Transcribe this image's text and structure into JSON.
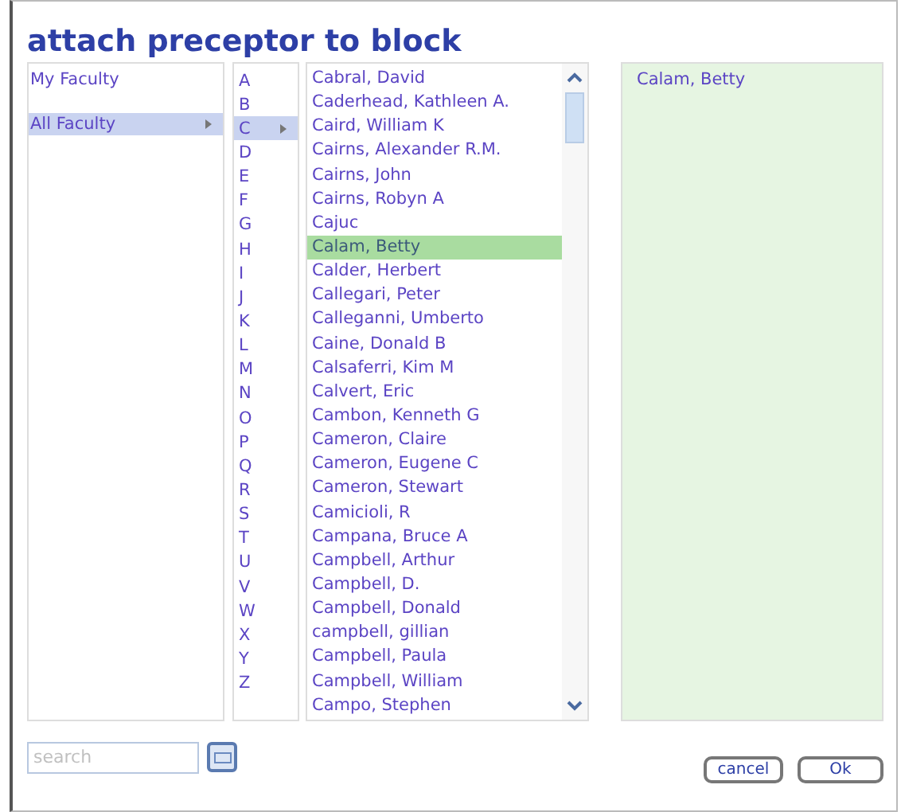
{
  "title": "attach preceptor to block",
  "faculty": [
    {
      "label": "My Faculty",
      "selected": false
    },
    {
      "label": "All Faculty",
      "selected": true
    }
  ],
  "letters": [
    {
      "label": "A",
      "selected": false
    },
    {
      "label": "B",
      "selected": false
    },
    {
      "label": "C",
      "selected": true
    },
    {
      "label": "D",
      "selected": false
    },
    {
      "label": "E",
      "selected": false
    },
    {
      "label": "F",
      "selected": false
    },
    {
      "label": "G",
      "selected": false
    },
    {
      "label": "H",
      "selected": false
    },
    {
      "label": "I",
      "selected": false
    },
    {
      "label": "J",
      "selected": false
    },
    {
      "label": "K",
      "selected": false
    },
    {
      "label": "L",
      "selected": false
    },
    {
      "label": "M",
      "selected": false
    },
    {
      "label": "N",
      "selected": false
    },
    {
      "label": "O",
      "selected": false
    },
    {
      "label": "P",
      "selected": false
    },
    {
      "label": "Q",
      "selected": false
    },
    {
      "label": "R",
      "selected": false
    },
    {
      "label": "S",
      "selected": false
    },
    {
      "label": "T",
      "selected": false
    },
    {
      "label": "U",
      "selected": false
    },
    {
      "label": "V",
      "selected": false
    },
    {
      "label": "W",
      "selected": false
    },
    {
      "label": "X",
      "selected": false
    },
    {
      "label": "Y",
      "selected": false
    },
    {
      "label": "Z",
      "selected": false
    }
  ],
  "names": [
    {
      "label": "Cabral, David",
      "selected": false
    },
    {
      "label": "Caderhead, Kathleen A.",
      "selected": false
    },
    {
      "label": "Caird, William K",
      "selected": false
    },
    {
      "label": "Cairns, Alexander R.M.",
      "selected": false
    },
    {
      "label": "Cairns, John",
      "selected": false
    },
    {
      "label": "Cairns, Robyn A",
      "selected": false
    },
    {
      "label": "Cajuc",
      "selected": false
    },
    {
      "label": "Calam, Betty",
      "selected": true
    },
    {
      "label": "Calder, Herbert",
      "selected": false
    },
    {
      "label": "Callegari, Peter",
      "selected": false
    },
    {
      "label": "Calleganni, Umberto",
      "selected": false
    },
    {
      "label": "Caine, Donald B",
      "selected": false
    },
    {
      "label": "Calsaferri, Kim M",
      "selected": false
    },
    {
      "label": "Calvert, Eric",
      "selected": false
    },
    {
      "label": "Cambon, Kenneth G",
      "selected": false
    },
    {
      "label": "Cameron, Claire",
      "selected": false
    },
    {
      "label": "Cameron, Eugene C",
      "selected": false
    },
    {
      "label": "Cameron, Stewart",
      "selected": false
    },
    {
      "label": "Camicioli, R",
      "selected": false
    },
    {
      "label": "Campana, Bruce A",
      "selected": false
    },
    {
      "label": "Campbell, Arthur",
      "selected": false
    },
    {
      "label": "Campbell, D.",
      "selected": false
    },
    {
      "label": "Campbell, Donald",
      "selected": false
    },
    {
      "label": "campbell, gillian",
      "selected": false
    },
    {
      "label": "Campbell, Paula",
      "selected": false
    },
    {
      "label": "Campbell, William",
      "selected": false
    },
    {
      "label": "Campo, Stephen",
      "selected": false
    }
  ],
  "attached": [
    "Calam, Betty"
  ],
  "search": {
    "placeholder": "search"
  },
  "buttons": [
    "cancel",
    "Ok"
  ]
}
